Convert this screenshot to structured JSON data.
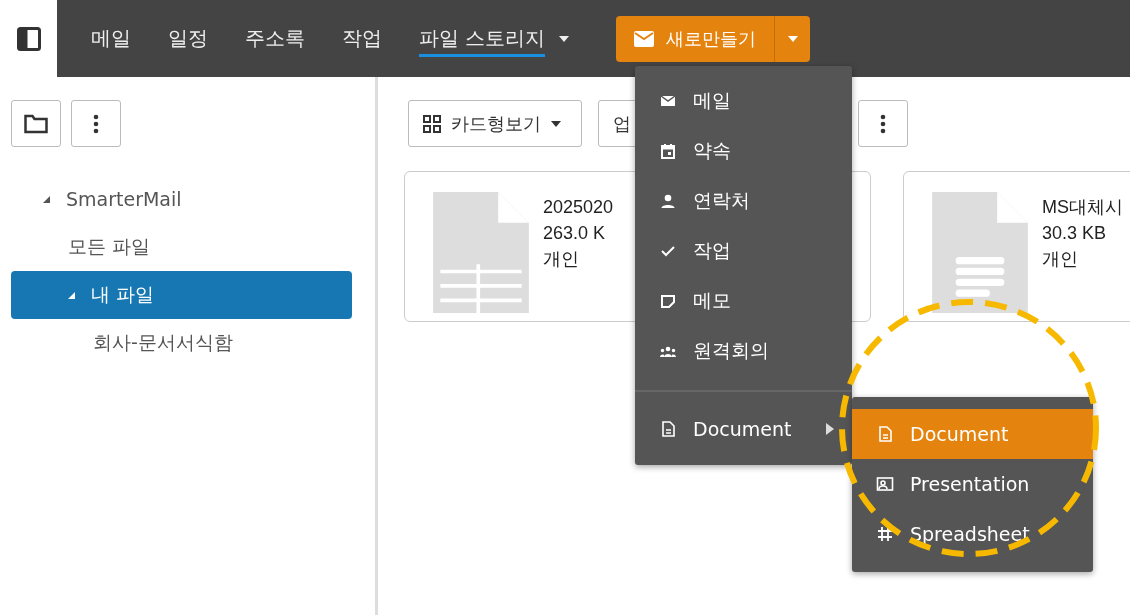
{
  "nav": {
    "tabs": [
      {
        "label": "메일",
        "selected": false,
        "dropdown": false
      },
      {
        "label": "일정",
        "selected": false,
        "dropdown": false
      },
      {
        "label": "주소록",
        "selected": false,
        "dropdown": false
      },
      {
        "label": "작업",
        "selected": false,
        "dropdown": false
      },
      {
        "label": "파일 스토리지",
        "selected": true,
        "dropdown": true
      }
    ],
    "new_button": {
      "label": "새로만들기"
    }
  },
  "sidebar": {
    "tree": [
      {
        "label": "SmarterMail",
        "selected": false,
        "expanded": true,
        "children": [
          {
            "label": "모든 파일",
            "selected": false
          },
          {
            "label": "내 파일",
            "selected": true,
            "expanded": true,
            "children": [
              {
                "label": "회사-문서서식함",
                "selected": false
              }
            ]
          }
        ]
      }
    ]
  },
  "toolbar": {
    "view_button": {
      "label": "카드형보기"
    },
    "upload_button": {
      "label": "업"
    }
  },
  "files": [
    {
      "name": "2025020",
      "size": "263.0 K",
      "owner": "개인",
      "kind": "spreadsheet"
    },
    {
      "name": "MS대체시",
      "size": "30.3 KB",
      "owner": "개인",
      "kind": "document"
    }
  ],
  "new_menu": {
    "items": [
      {
        "label": "메일",
        "kind": "mail"
      },
      {
        "label": "약속",
        "kind": "calendar"
      },
      {
        "label": "연락처",
        "kind": "person"
      },
      {
        "label": "작업",
        "kind": "check"
      },
      {
        "label": "메모",
        "kind": "note"
      },
      {
        "label": "원격회의",
        "kind": "people"
      }
    ],
    "document_item": {
      "label": "Document",
      "kind": "document"
    },
    "submenu": [
      {
        "label": "Document",
        "kind": "document",
        "selected": true
      },
      {
        "label": "Presentation",
        "kind": "presentation",
        "selected": false
      },
      {
        "label": "Spreadsheet",
        "kind": "grid",
        "selected": false
      }
    ]
  }
}
